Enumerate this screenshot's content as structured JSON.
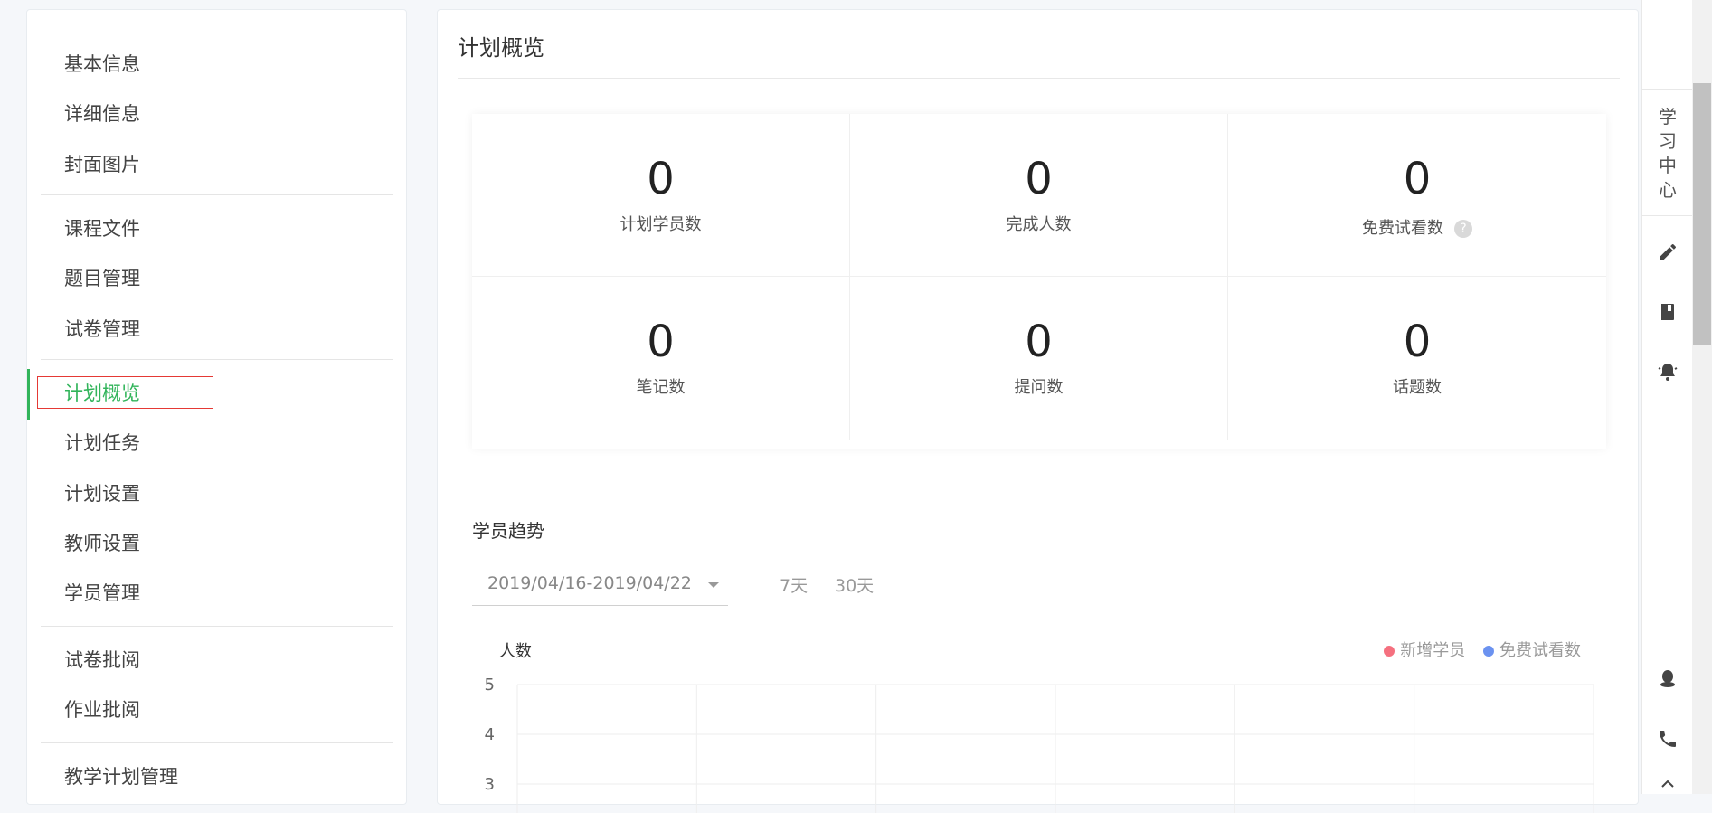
{
  "sidebar": {
    "items": [
      {
        "label": "基本信息"
      },
      {
        "label": "详细信息"
      },
      {
        "label": "封面图片"
      },
      {
        "label": "课程文件"
      },
      {
        "label": "题目管理"
      },
      {
        "label": "试卷管理"
      },
      {
        "label": "计划概览",
        "active": true
      },
      {
        "label": "计划任务"
      },
      {
        "label": "计划设置"
      },
      {
        "label": "教师设置"
      },
      {
        "label": "学员管理"
      },
      {
        "label": "试卷批阅"
      },
      {
        "label": "作业批阅"
      },
      {
        "label": "教学计划管理"
      }
    ]
  },
  "main": {
    "title": "计划概览",
    "stats": [
      {
        "value": "0",
        "label": "计划学员数"
      },
      {
        "value": "0",
        "label": "完成人数"
      },
      {
        "value": "0",
        "label": "免费试看数",
        "help_icon": "question-circle-icon"
      },
      {
        "value": "0",
        "label": "笔记数"
      },
      {
        "value": "0",
        "label": "提问数"
      },
      {
        "value": "0",
        "label": "话题数"
      }
    ],
    "trend": {
      "title": "学员趋势",
      "date_range": "2019/04/16-2019/04/22",
      "range_7": "7天",
      "range_30": "30天"
    }
  },
  "chart_data": {
    "type": "line",
    "ylabel": "人数",
    "y_ticks_visible": [
      "5",
      "4",
      "3"
    ],
    "ylim": [
      0,
      5
    ],
    "grid": true,
    "legend_position": "top-right",
    "series": [
      {
        "name": "新增学员",
        "color": "#f5707f",
        "values": []
      },
      {
        "name": "免费试看数",
        "color": "#6b92f0",
        "values": []
      }
    ]
  },
  "toolbar": {
    "study_center_chars": [
      "学",
      "习",
      "中",
      "心"
    ],
    "icons": [
      "edit-icon",
      "book-icon",
      "bell-icon",
      "qq-icon",
      "phone-icon",
      "top-icon"
    ]
  },
  "colors": {
    "accent": "#31b45a",
    "highlight_border": "#e53935"
  }
}
